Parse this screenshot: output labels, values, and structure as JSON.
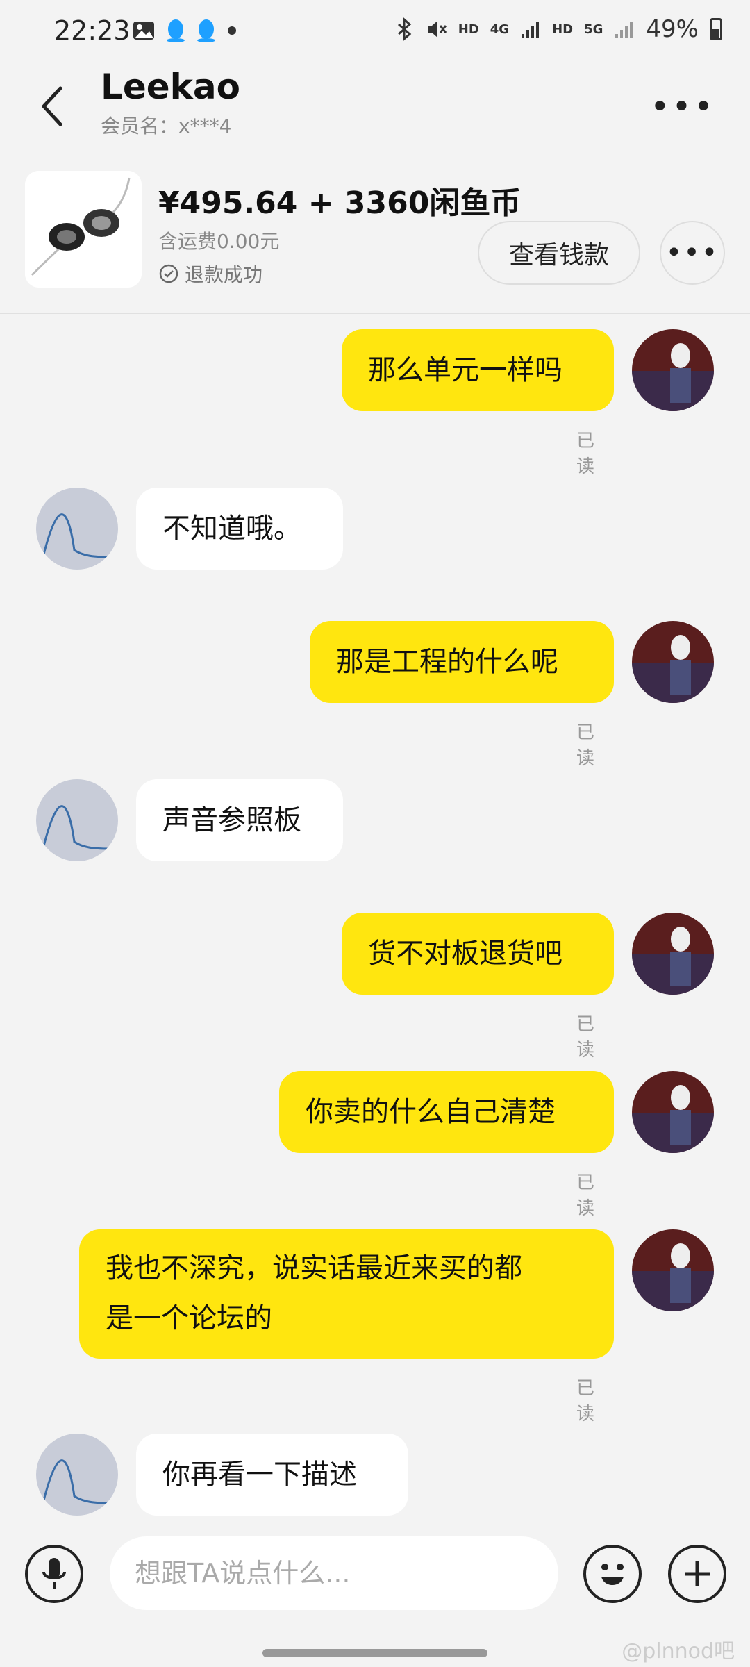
{
  "status_bar": {
    "time": "22:23",
    "hd1": "HD",
    "net1": "4G",
    "hd2": "HD",
    "net2": "5G",
    "battery": "49%"
  },
  "header": {
    "title": "Leekao",
    "subtitle": "会员名：x***4"
  },
  "product": {
    "price": "¥495.64 + 3360闲鱼币",
    "shipping": "含运费0.00元",
    "status": "退款成功",
    "view_money_button": "查看钱款"
  },
  "messages": [
    {
      "from": "me",
      "text": "那么单元一样吗",
      "read": "已读"
    },
    {
      "from": "them",
      "text": "不知道哦。"
    },
    {
      "from": "me",
      "text": "那是工程的什么呢",
      "read": "已读"
    },
    {
      "from": "them",
      "text": "声音参照板"
    },
    {
      "from": "me",
      "text": "货不对板退货吧",
      "read": "已读"
    },
    {
      "from": "me",
      "text": "你卖的什么自己清楚",
      "read": "已读"
    },
    {
      "from": "me",
      "text_line1": "我也不深究，说实话最近来买的都",
      "text_line2": "是一个论坛的",
      "read": "已读"
    },
    {
      "from": "them",
      "text": "你再看一下描述"
    }
  ],
  "input": {
    "placeholder": "想跟TA说点什么..."
  },
  "watermark": "@plnnod吧",
  "colors": {
    "my_bubble": "#ffe60f",
    "their_bubble": "#ffffff",
    "background": "#f3f3f3"
  }
}
